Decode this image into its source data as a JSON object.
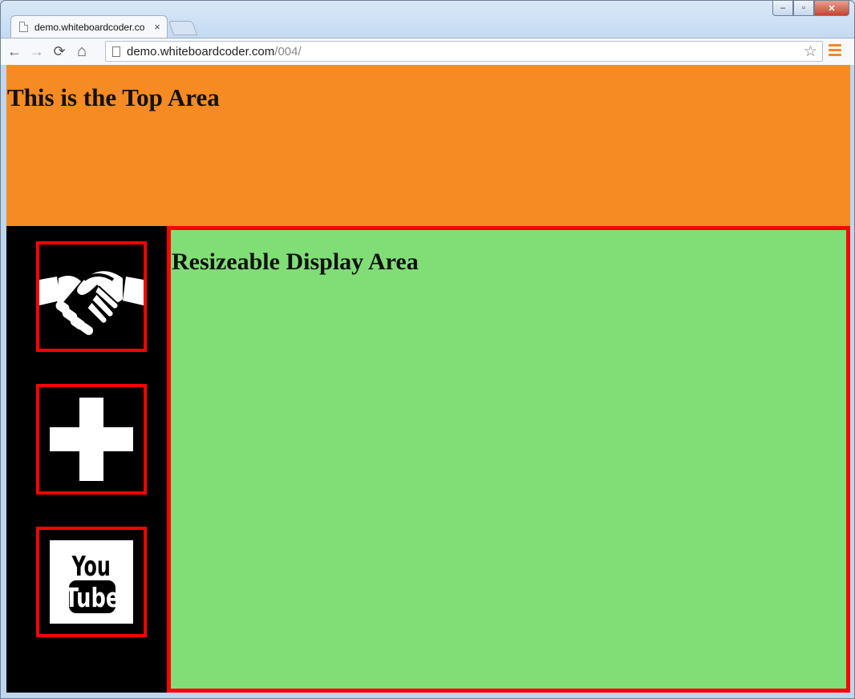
{
  "browser": {
    "tab_title": "demo.whiteboardcoder.co",
    "tab_close": "×",
    "url_host": "demo.whiteboardcoder.com",
    "url_path": "/004/",
    "window_buttons": {
      "minimize": "–",
      "maximize": "▫",
      "close": "✕"
    },
    "nav": {
      "back": "←",
      "forward": "→",
      "reload": "⟳",
      "home": "⌂",
      "star": "☆"
    }
  },
  "page": {
    "top_area_title": "This is the Top Area",
    "display_title": "Resizeable Display Area",
    "colors": {
      "top_area": "#f58b22",
      "sidebar": "#000000",
      "display_area": "#81de77",
      "border_accent": "#ff0000"
    },
    "sidebar_icons": [
      {
        "name": "handshake-icon"
      },
      {
        "name": "plus-icon"
      },
      {
        "name": "youtube-icon",
        "text_line1": "You",
        "text_line2": "Tube"
      }
    ]
  }
}
